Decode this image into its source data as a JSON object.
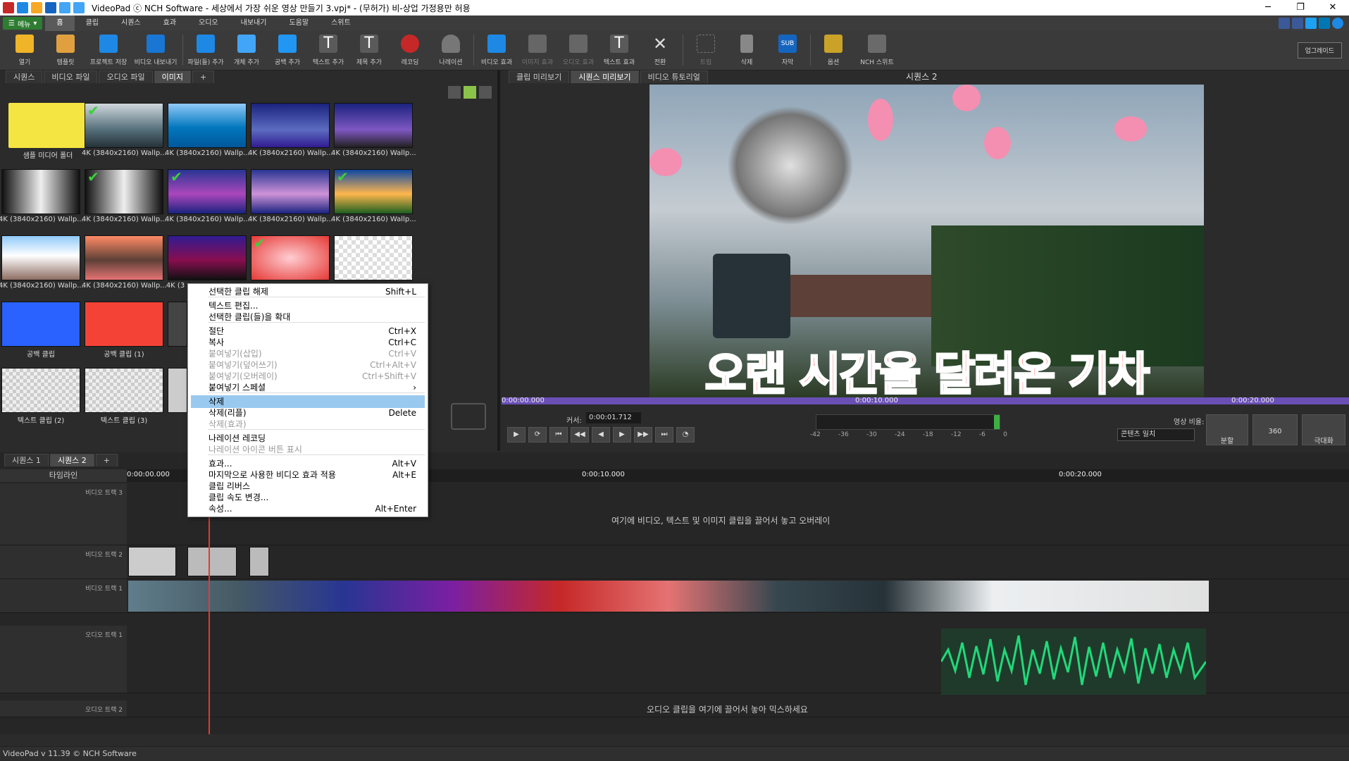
{
  "window": {
    "title": "VideoPad ⓒ NCH Software - 세상에서 가장 쉬운 영상 만들기 3.vpj* - (무허가) 비-상업 가정용만 허용",
    "minimize": "─",
    "restore": "❐",
    "close": "✕"
  },
  "menu": {
    "main_button": "메뉴",
    "tabs": [
      "홈",
      "클립",
      "시퀀스",
      "효과",
      "오디오",
      "내보내기",
      "도움말",
      "스위트"
    ]
  },
  "toolbar": {
    "items": [
      "열기",
      "템플릿",
      "프로젝트 저장",
      "비디오 내보내기",
      "파일(들) 추가",
      "개체 추가",
      "공백 추가",
      "텍스트 추가",
      "제목 추가",
      "레코딩",
      "나레이션",
      "비디오 효과",
      "이미지 효과",
      "오디오 효과",
      "텍스트 효과",
      "전환",
      "트림",
      "삭제",
      "자막",
      "옵션",
      "NCH 스위트"
    ],
    "upgrade": "업그레이드",
    "sub_badge": "SUB"
  },
  "bin": {
    "tabs": [
      "시퀀스",
      "비디오 파일",
      "오디오 파일",
      "이미지"
    ],
    "add_tab": "+",
    "captions": {
      "folder": "샘플 미디어 폴더",
      "wall": "4K (3840x2160) Wallp...",
      "blank1": "공백 클립",
      "blank2": "공백 클립 (1)",
      "text2": "텍스트 클립 (2)",
      "text3": "텍스트 클립 (3)",
      "partial": "4K (3"
    }
  },
  "preview": {
    "tabs": [
      "클립 미리보기",
      "시퀀스 미리보기",
      "비디오 튜토리얼"
    ],
    "title": "시퀀스 2",
    "subtitle_text": "오랜 시간을 달려온 기차",
    "ruler_start": "0:00:00.000",
    "ruler_mid": "0:00:10.000",
    "ruler_end": "0:00:20.000",
    "cursor_label": "커서:",
    "cursor_value": "0:00:01.712",
    "aspect_label": "영상 비율:",
    "aspect_value": "콘텐츠 일치",
    "meter_scale": [
      "-42",
      "-36",
      "-30",
      "-24",
      "-18",
      "-12",
      "-6",
      "0"
    ],
    "btn_split": "분할",
    "btn_360": "360",
    "btn_fullscreen": "극대화"
  },
  "timeline": {
    "tabs": [
      "시퀀스 1",
      "시퀀스 2"
    ],
    "add_tab": "+",
    "label": "타임라인",
    "ruler": [
      "0:00:00.000",
      "0:00:10.000",
      "0:00:20.000"
    ],
    "tracks": {
      "v3": "비디오 트랙 3",
      "v2": "비디오 트랙 2",
      "v1": "비디오 트랙 1",
      "a1": "오디오 트랙 1",
      "a2": "오디오 트랙 2"
    },
    "overlay_hint": "여기에 비디오, 텍스트 및 이미지 클립을 끌어서 놓고 오버레이",
    "audio_hint": "오디오 클립을 여기에 끌어서 놓아 믹스하세요"
  },
  "context_menu": [
    {
      "label": "선택한 클립 해제",
      "shortcut": "Shift+L",
      "disabled": false
    },
    {
      "label": "텍스트 편집...",
      "shortcut": "",
      "disabled": false
    },
    {
      "label": "선택한 클립(들)을 확대",
      "shortcut": "",
      "disabled": false
    },
    {
      "label": "절단",
      "shortcut": "Ctrl+X",
      "disabled": false
    },
    {
      "label": "복사",
      "shortcut": "Ctrl+C",
      "disabled": false
    },
    {
      "label": "붙여넣기(삽입)",
      "shortcut": "Ctrl+V",
      "disabled": true
    },
    {
      "label": "붙여넣기(덮어쓰기)",
      "shortcut": "Ctrl+Alt+V",
      "disabled": true
    },
    {
      "label": "붙여넣기(오버레이)",
      "shortcut": "Ctrl+Shift+V",
      "disabled": true
    },
    {
      "label": "붙여넣기 스페셜",
      "shortcut": "›",
      "disabled": false
    },
    {
      "label": "삭제",
      "shortcut": "",
      "disabled": false,
      "highlighted": true
    },
    {
      "label": "삭제(리플)",
      "shortcut": "Delete",
      "disabled": false
    },
    {
      "label": "삭제(효과)",
      "shortcut": "",
      "disabled": true
    },
    {
      "label": "나레이션 레코딩",
      "shortcut": "",
      "disabled": false
    },
    {
      "label": "나레이션 아이콘 버튼 표시",
      "shortcut": "",
      "disabled": true
    },
    {
      "label": "효과...",
      "shortcut": "Alt+V",
      "disabled": false
    },
    {
      "label": "마지막으로 사용한 비디오 효과 적용",
      "shortcut": "Alt+E",
      "disabled": false
    },
    {
      "label": "클립 리버스",
      "shortcut": "",
      "disabled": false
    },
    {
      "label": "클립 속도 변경...",
      "shortcut": "",
      "disabled": false
    },
    {
      "label": "속성...",
      "shortcut": "Alt+Enter",
      "disabled": false
    }
  ],
  "status": {
    "text": "VideoPad v 11.39 © NCH Software"
  },
  "colors": {
    "accent_green": "#2e7d32",
    "ruler_purple": "#6a4fb5",
    "highlight": "#99c9ef",
    "subtitle_red": "#ff1515",
    "wave_green": "#21d97a"
  }
}
